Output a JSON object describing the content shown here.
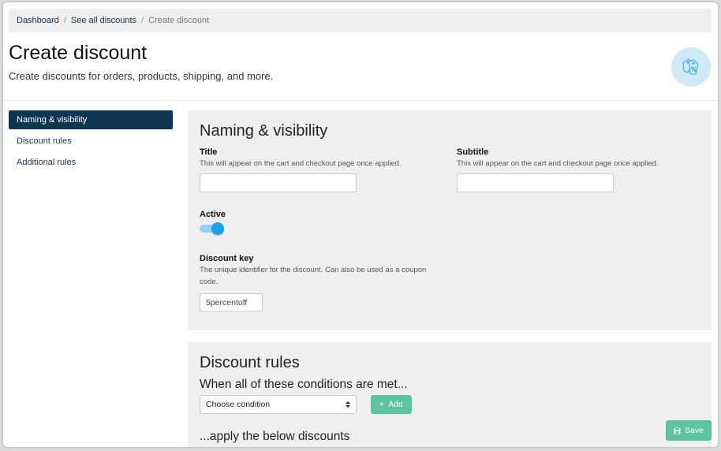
{
  "breadcrumb": {
    "items": [
      "Dashboard",
      "See all discounts"
    ],
    "separator": "/",
    "current": "Create discount"
  },
  "header": {
    "title": "Create discount",
    "subtitle": "Create discounts for orders, products, shipping, and more.",
    "icon": "price-tags-icon"
  },
  "sidebar": {
    "items": [
      {
        "label": "Naming & visibility",
        "active": true
      },
      {
        "label": "Discount rules",
        "active": false
      },
      {
        "label": "Additional rules",
        "active": false
      }
    ]
  },
  "naming": {
    "heading": "Naming & visibility",
    "title_field": {
      "label": "Title",
      "help": "This will appear on the cart and checkout page once applied.",
      "value": ""
    },
    "subtitle_field": {
      "label": "Subtitle",
      "help": "This will appear on the cart and checkout page once applied.",
      "value": ""
    },
    "active": {
      "label": "Active",
      "checked": true
    },
    "key_field": {
      "label": "Discount key",
      "help": "The unique identifier for the discount. Can also be used as a coupon code.",
      "value": "5percentoff"
    }
  },
  "rules": {
    "heading": "Discount rules",
    "conditions_heading": "When all of these conditions are met...",
    "condition_select": "Choose condition",
    "add_label": "Add",
    "discounts_heading": "...apply the below discounts"
  },
  "actions": {
    "save_label": "Save"
  },
  "colors": {
    "primary": "#0f3552",
    "panel": "#efefef",
    "accent_green": "#5fc2a0",
    "toggle_on": "#1e9fe6"
  }
}
